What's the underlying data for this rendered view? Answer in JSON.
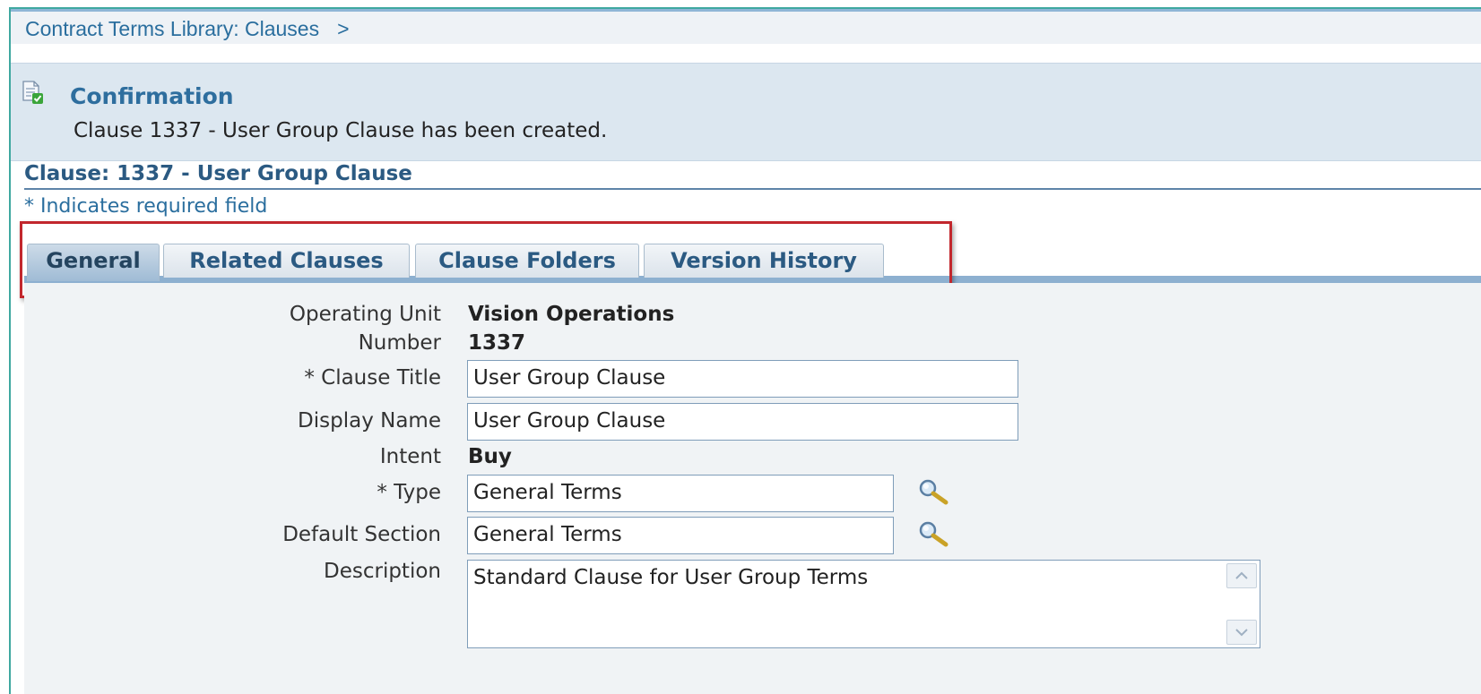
{
  "breadcrumb": {
    "item": "Contract Terms Library: Clauses",
    "separator": ">"
  },
  "confirmation": {
    "icon": "document-check-icon",
    "title": "Confirmation",
    "message": "Clause 1337 - User Group Clause has been created."
  },
  "header": {
    "title": "Clause: 1337 - User Group Clause",
    "required_note": "* Indicates required field"
  },
  "tabs": [
    {
      "label": "General",
      "active": true
    },
    {
      "label": "Related Clauses",
      "active": false
    },
    {
      "label": "Clause Folders",
      "active": false
    },
    {
      "label": "Version History",
      "active": false
    }
  ],
  "form": {
    "operating_unit": {
      "label": "Operating Unit",
      "value": "Vision Operations"
    },
    "number": {
      "label": "Number",
      "value": "1337"
    },
    "clause_title": {
      "label": "* Clause Title",
      "value": "User Group Clause"
    },
    "display_name": {
      "label": "Display Name",
      "value": "User Group Clause"
    },
    "intent": {
      "label": "Intent",
      "value": "Buy"
    },
    "type": {
      "label": "* Type",
      "value": "General Terms"
    },
    "default_section": {
      "label": "Default Section",
      "value": "General Terms"
    },
    "description": {
      "label": "Description",
      "value": "Standard Clause for User Group Terms"
    }
  },
  "colors": {
    "accent": "#2a6e9e",
    "highlight": "#c2272d",
    "tab_active": "#9fbbd5"
  }
}
